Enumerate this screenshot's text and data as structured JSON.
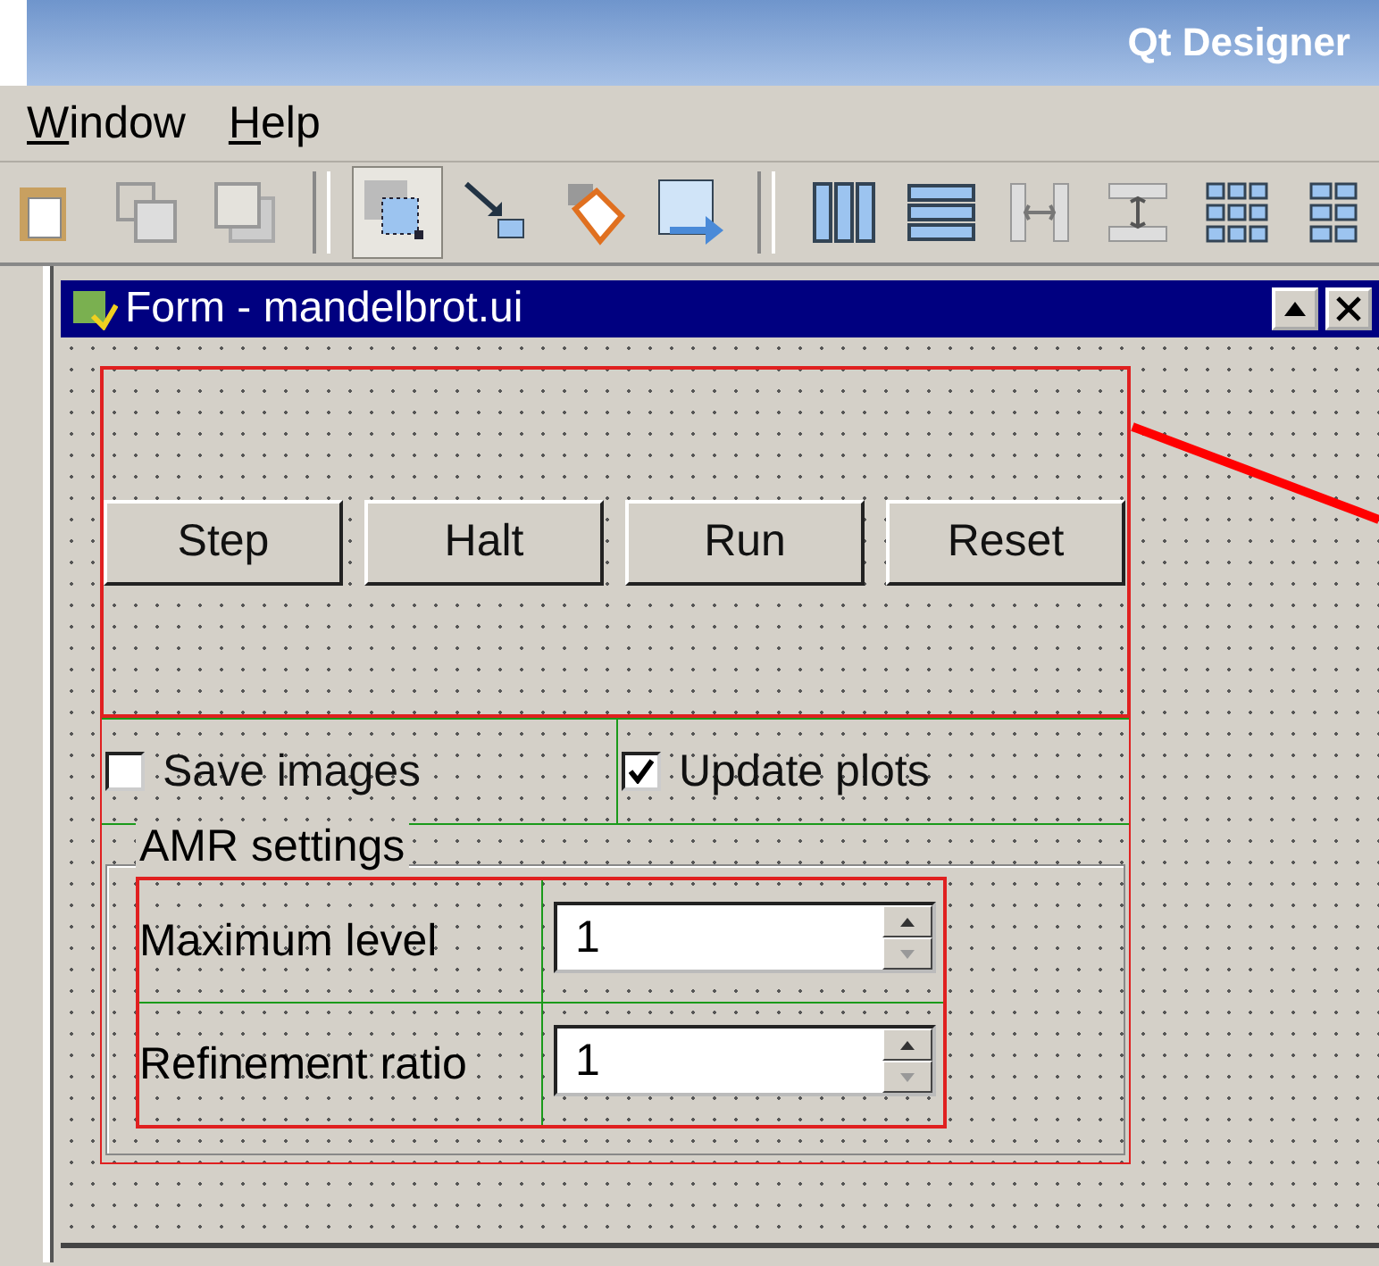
{
  "app": {
    "title": "Qt Designer"
  },
  "menu": [
    {
      "label": "Window"
    },
    {
      "label": "Help"
    }
  ],
  "toolbar": [
    {
      "kind": "paste",
      "selected": false
    },
    {
      "kind": "front",
      "selected": false
    },
    {
      "kind": "back",
      "selected": false
    },
    {
      "kind": "sep"
    },
    {
      "kind": "widgets",
      "selected": true
    },
    {
      "kind": "signals",
      "selected": false
    },
    {
      "kind": "buddies",
      "selected": false
    },
    {
      "kind": "taborder",
      "selected": false
    },
    {
      "kind": "sep"
    },
    {
      "kind": "hlayout",
      "selected": false
    },
    {
      "kind": "vlayout",
      "selected": false
    },
    {
      "kind": "hsplit",
      "selected": false
    },
    {
      "kind": "vsplit",
      "selected": false
    },
    {
      "kind": "grid",
      "selected": false
    },
    {
      "kind": "form",
      "selected": false
    }
  ],
  "form": {
    "title": "Form - mandelbrot.ui",
    "buttons": [
      {
        "label": "Step"
      },
      {
        "label": "Halt"
      },
      {
        "label": "Run"
      },
      {
        "label": "Reset"
      }
    ],
    "checkboxes": [
      {
        "label": "Save images",
        "checked": false
      },
      {
        "label": "Update plots",
        "checked": true
      }
    ],
    "group": {
      "title": "AMR settings",
      "fields": [
        {
          "label": "Maximum level",
          "value": "1"
        },
        {
          "label": "Refinement ratio",
          "value": "1"
        }
      ]
    }
  }
}
